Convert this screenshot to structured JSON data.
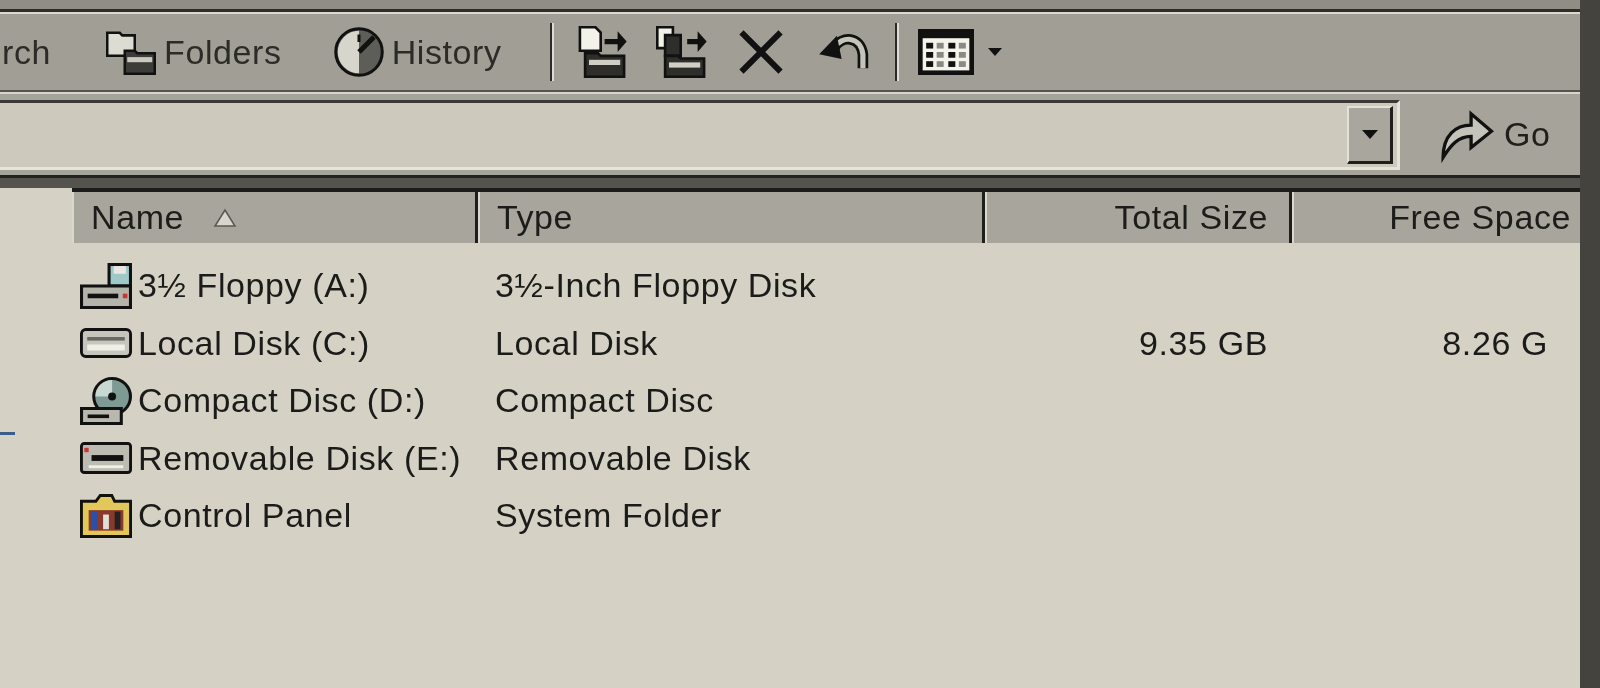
{
  "toolbar": {
    "buttons": [
      {
        "label": "rch"
      },
      {
        "label": "Folders"
      },
      {
        "label": "History"
      }
    ]
  },
  "address_bar": {
    "go_button": {
      "label": "Go"
    }
  },
  "table": {
    "columns": [
      {
        "label": "Name",
        "kind": "text",
        "sorted": true
      },
      {
        "label": "Type",
        "kind": "text",
        "sorted": false
      },
      {
        "label": "Total Size",
        "kind": "number",
        "sorted": false
      },
      {
        "label": "Free Space",
        "kind": "number",
        "sorted": false
      }
    ],
    "rows": [
      {
        "kind": "floppy",
        "name": "3½ Floppy (A:)",
        "type": "3½-Inch Floppy Disk",
        "selected": false
      },
      {
        "kind": "harddisk",
        "name": "Local Disk (C:)",
        "type": "Local Disk",
        "total_size": "9.35 GB",
        "free_space": "8.26 G",
        "selected": false
      },
      {
        "kind": "cdrom",
        "name": "Compact Disc (D:)",
        "type": "Compact Disc",
        "selected": false
      },
      {
        "kind": "removable",
        "name": "Removable Disk (E:)",
        "type": "Removable Disk",
        "selected": false
      },
      {
        "kind": "folder",
        "name": "Control Panel",
        "type": "System Folder",
        "selected": false
      }
    ]
  }
}
